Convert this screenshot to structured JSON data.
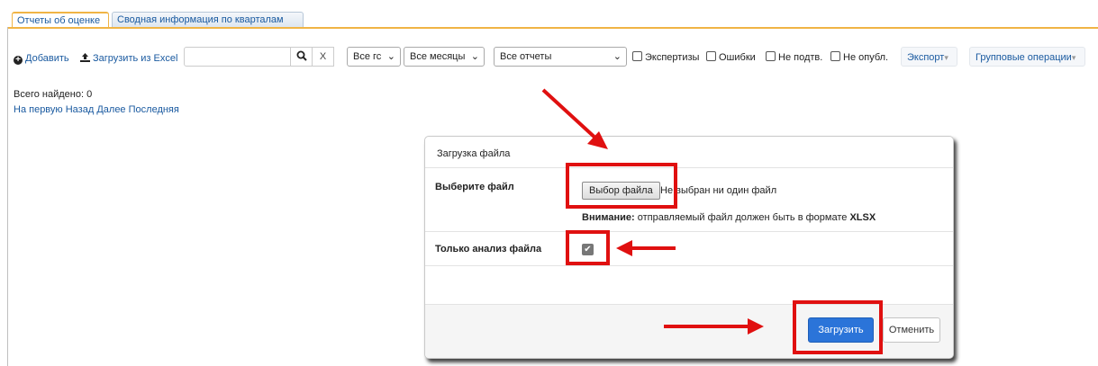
{
  "tabs": [
    {
      "label": "Отчеты об оценке",
      "active": true
    },
    {
      "label": "Сводная информация по кварталам",
      "active": false
    }
  ],
  "toolbar": {
    "add_label": "Добавить",
    "upload_label": "Загрузить из Excel",
    "search_value": "",
    "search_clear": "X",
    "year_select": "Все гс",
    "month_select": "Все месяцы",
    "reports_select": "Все отчеты",
    "checkboxes": [
      "Экспертизы",
      "Ошибки",
      "Не подтв.",
      "Не опубл."
    ],
    "export_label": "Экспорт",
    "group_ops_label": "Групповые операции"
  },
  "results": {
    "total_text": "Всего найдено: 0",
    "pager": [
      "На первую",
      "Назад",
      "Далее",
      "Последняя"
    ]
  },
  "modal": {
    "title": "Загрузка файла",
    "file_label": "Выберите файл",
    "file_button": "Выбор файла",
    "file_status": "Не выбран ни один файл",
    "note_prefix": "Внимание:",
    "note_text": " отправляемый файл должен быть в формате ",
    "note_format": "XLSX",
    "only_analysis_label": "Только анализ файла",
    "only_analysis_checked": true,
    "submit_label": "Загрузить",
    "cancel_label": "Отменить"
  },
  "colors": {
    "accent": "#f0b445",
    "link": "#1a5aa0",
    "primary": "#2b74d9",
    "annotation": "#e01010"
  }
}
